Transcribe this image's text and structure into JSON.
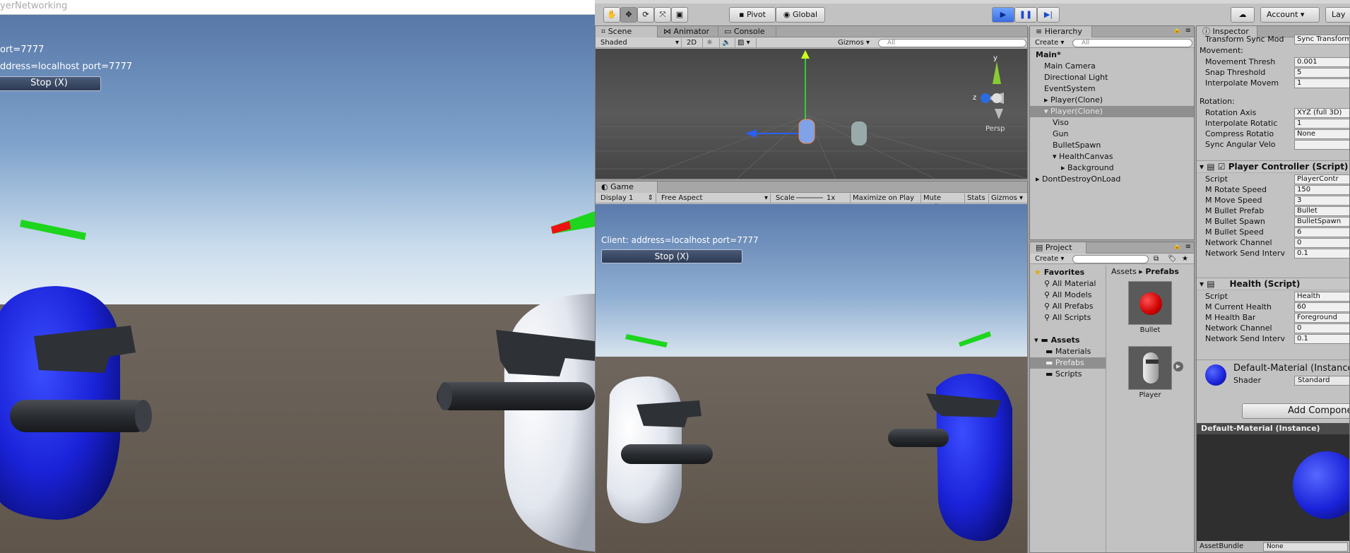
{
  "left_window": {
    "title": "yerNetworking",
    "hud_line1": "ort=7777",
    "hud_line2": "ddress=localhost port=7777",
    "stop_button": "Stop (X)"
  },
  "toolbar": {
    "pivot": "Pivot",
    "global": "Global",
    "account": "Account",
    "layers": "Lay"
  },
  "scene_panel": {
    "tabs": [
      "Scene",
      "Animator",
      "Console"
    ],
    "shading": "Shaded",
    "mode_2d": "2D",
    "gizmos": "Gizmos",
    "search_placeholder": "All",
    "persp_label": "Persp",
    "axis_y": "y",
    "axis_z": "z"
  },
  "game_panel": {
    "tab": "Game",
    "display": "Display 1",
    "aspect": "Free Aspect",
    "scale_label": "Scale",
    "scale_value": "1x",
    "maximize": "Maximize on Play",
    "mute": "Mute audio",
    "stats": "Stats",
    "gizmos": "Gizmos",
    "client_text": "Client: address=localhost port=7777",
    "stop_button": "Stop (X)"
  },
  "hierarchy": {
    "tab": "Hierarchy",
    "create": "Create",
    "search_placeholder": "All",
    "items": [
      {
        "label": "Main*",
        "indent": 0,
        "bold": true
      },
      {
        "label": "Main Camera",
        "indent": 1
      },
      {
        "label": "Directional Light",
        "indent": 1
      },
      {
        "label": "EventSystem",
        "indent": 1
      },
      {
        "label": "Player(Clone)",
        "indent": 1
      },
      {
        "label": "Player(Clone)",
        "indent": 1,
        "selected": true
      },
      {
        "label": "Viso",
        "indent": 2
      },
      {
        "label": "Gun",
        "indent": 2
      },
      {
        "label": "BulletSpawn",
        "indent": 2
      },
      {
        "label": "HealthCanvas",
        "indent": 2
      },
      {
        "label": "Background",
        "indent": 3
      },
      {
        "label": "DontDestroyOnLoad",
        "indent": 0
      }
    ]
  },
  "project": {
    "tab": "Project",
    "create": "Create",
    "favorites_label": "Favorites",
    "favorites": [
      "All Material",
      "All Models",
      "All Prefabs",
      "All Scripts"
    ],
    "assets_label": "Assets",
    "folders": [
      "Materials",
      "Prefabs",
      "Scripts"
    ],
    "breadcrumb_assets": "Assets",
    "breadcrumb_prefabs": "Prefabs",
    "assets": [
      {
        "name": "Bullet"
      },
      {
        "name": "Player"
      }
    ]
  },
  "inspector": {
    "tab": "Inspector",
    "top_partial_label": "Transform Sync Mod",
    "top_partial_value": "Sync Transform",
    "movement_label": "Movement:",
    "movement_rows": [
      {
        "label": "Movement Thresh",
        "value": "0.001"
      },
      {
        "label": "Snap Threshold",
        "value": "5"
      },
      {
        "label": "Interpolate Movem",
        "value": "1"
      }
    ],
    "rotation_label": "Rotation:",
    "rotation_rows": [
      {
        "label": "Rotation Axis",
        "value": "XYZ (full 3D)"
      },
      {
        "label": "Interpolate Rotatic",
        "value": "1"
      },
      {
        "label": "Compress Rotatio",
        "value": "None"
      },
      {
        "label": "Sync Angular Velo",
        "value": ""
      }
    ],
    "player_controller": {
      "title": "Player Controller (Script)",
      "rows": [
        {
          "label": "Script",
          "value": "PlayerContr"
        },
        {
          "label": "M Rotate Speed",
          "value": "150"
        },
        {
          "label": "M Move Speed",
          "value": "3"
        },
        {
          "label": "M Bullet Prefab",
          "value": "Bullet"
        },
        {
          "label": "M Bullet Spawn",
          "value": "BulletSpawn"
        },
        {
          "label": "M Bullet Speed",
          "value": "6"
        },
        {
          "label": "Network Channel",
          "value": "0"
        },
        {
          "label": "Network Send Interv",
          "value": "0.1"
        }
      ]
    },
    "health": {
      "title": "Health (Script)",
      "rows": [
        {
          "label": "Script",
          "value": "Health"
        },
        {
          "label": "M Current Health",
          "value": "60"
        },
        {
          "label": "M Health Bar",
          "value": "Foreground"
        },
        {
          "label": "Network Channel",
          "value": "0"
        },
        {
          "label": "Network Send Interv",
          "value": "0.1"
        }
      ]
    },
    "material_name": "Default-Material (Instance",
    "shader_label": "Shader",
    "shader_value": "Standard",
    "add_component": "Add Componen",
    "preview_title": "Default-Material (Instance)",
    "assetbundle_label": "AssetBundle",
    "assetbundle_value": "None"
  }
}
